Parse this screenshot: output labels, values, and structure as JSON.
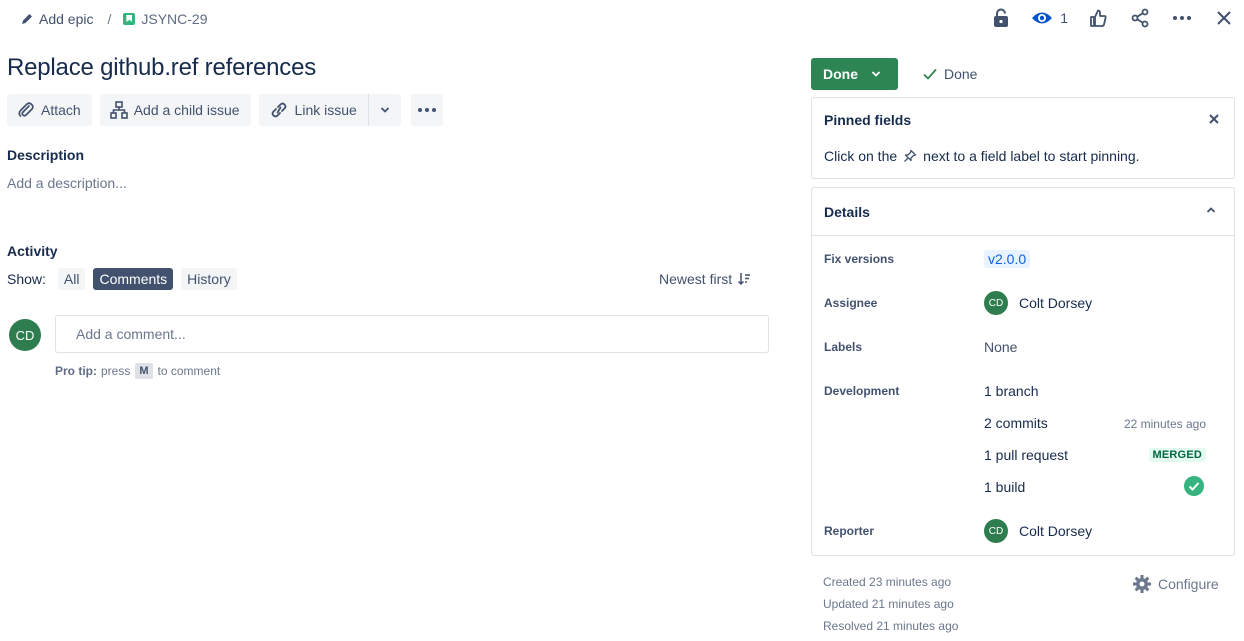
{
  "breadcrumb": {
    "add_epic": "Add epic",
    "separator": "/",
    "issue_key": "JSYNC-29"
  },
  "top_actions": {
    "watch_count": "1"
  },
  "issue": {
    "title": "Replace github.ref references"
  },
  "toolbar": {
    "attach": "Attach",
    "add_child": "Add a child issue",
    "link_issue": "Link issue"
  },
  "description": {
    "heading": "Description",
    "placeholder": "Add a description..."
  },
  "activity": {
    "heading": "Activity",
    "show_label": "Show:",
    "filters": [
      "All",
      "Comments",
      "History"
    ],
    "selected_filter": "Comments",
    "sort": "Newest first",
    "comment_avatar": "CD",
    "comment_placeholder": "Add a comment...",
    "protip_label": "Pro tip:",
    "protip_pre": "press",
    "protip_key": "M",
    "protip_post": "to comment"
  },
  "status": {
    "button": "Done",
    "resolution": "Done"
  },
  "pinned": {
    "heading": "Pinned fields",
    "text_pre": "Click on the",
    "text_post": "next to a field label to start pinning."
  },
  "details": {
    "heading": "Details",
    "fix_versions_label": "Fix versions",
    "fix_versions_value": "v2.0.0",
    "assignee_label": "Assignee",
    "assignee_initials": "CD",
    "assignee_name": "Colt Dorsey",
    "labels_label": "Labels",
    "labels_value": "None",
    "development_label": "Development",
    "dev_branch": "1 branch",
    "dev_commits": "2 commits",
    "dev_commits_time": "22 minutes ago",
    "dev_pr": "1 pull request",
    "dev_pr_status": "MERGED",
    "dev_build": "1 build",
    "reporter_label": "Reporter",
    "reporter_initials": "CD",
    "reporter_name": "Colt Dorsey"
  },
  "meta": {
    "created": "Created 23 minutes ago",
    "updated": "Updated 21 minutes ago",
    "resolved": "Resolved 21 minutes ago",
    "configure": "Configure"
  },
  "colors": {
    "status_done": "#2e8554",
    "avatar": "#2e7d4f",
    "build_success": "#36b37e"
  }
}
